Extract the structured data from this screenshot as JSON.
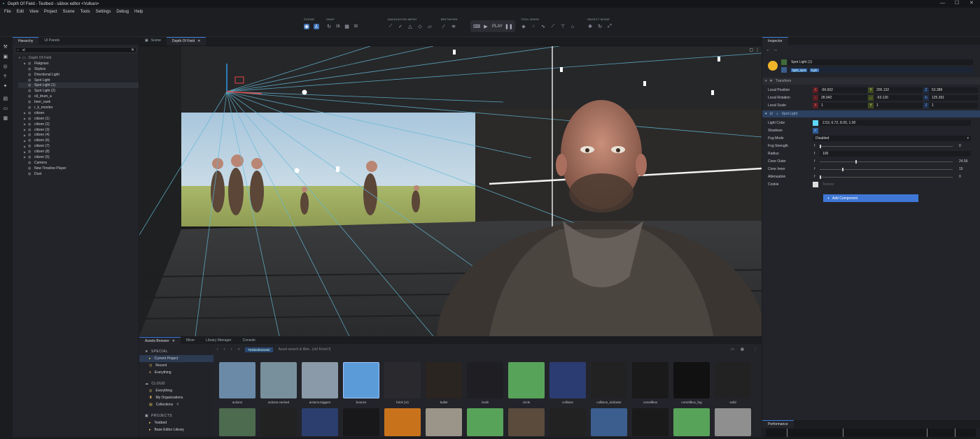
{
  "window": {
    "title": "Depth Of Field - Testbed - s&box editor <Vulkan>"
  },
  "menu": [
    "File",
    "Edit",
    "View",
    "Project",
    "Scene",
    "Tools",
    "Settings",
    "Debug",
    "Help"
  ],
  "toolbar": {
    "groups": [
      "SCENE",
      "SNAP",
      "NAVIGATION MESH",
      "BRITWORK",
      "TOOL MODE",
      "OBJECT MODE"
    ],
    "snap_angle": "15",
    "grid_size": "32",
    "play_label": "PLAY"
  },
  "hierarchy": {
    "tabs": [
      "Hierarchy",
      "UI Panels"
    ],
    "search_value": "sl",
    "root": "Depth Of Field",
    "items": [
      "Flatgrass",
      "Skybox",
      "Directional Light",
      "Spot Light",
      "Spot Light (1)",
      "Spot Light (2)",
      "oil_drum_a",
      "beer_cask",
      "r_k_monitor",
      "citizen",
      "citizen (1)",
      "citizen (2)",
      "citizen (3)",
      "citizen (4)",
      "citizen (6)",
      "citizen (7)",
      "citizen (8)",
      "citizen (5)",
      "Camera",
      "New Timeline Player",
      "Dust"
    ]
  },
  "viewport": {
    "tabs": [
      "Scene",
      "Depth Of Field"
    ]
  },
  "inspector": {
    "tab": "Inspector",
    "object_name": "Spot Light (1)",
    "tags": [
      "light_spot",
      "light"
    ],
    "transform_title": "Transform",
    "position": {
      "label": "Local Position",
      "x": "-56.602",
      "y": "205.132",
      "z": "53.389"
    },
    "rotation": {
      "label": "Local Rotation",
      "x": "28.942",
      "y": "-53.126",
      "z": "125.391"
    },
    "scale": {
      "label": "Local Scale",
      "x": "1",
      "y": "1",
      "z": "1"
    },
    "component_title": "Spot Light",
    "light_color": {
      "label": "Light Color",
      "value": "2.53, 6.72, 8.00, 1.00"
    },
    "shadows": "Shadows",
    "fog_mode": {
      "label": "Fog Mode",
      "value": "Disabled"
    },
    "fog_strength": {
      "label": "Fog Strength",
      "value": "0",
      "fraction": 0.0
    },
    "radius": {
      "label": "Radius",
      "value": "100"
    },
    "cone_outer": {
      "label": "Cone Outer",
      "value": "24.56",
      "fraction": 0.27
    },
    "cone_inner": {
      "label": "Cone Inner",
      "value": "15",
      "fraction": 0.17
    },
    "attenuation": {
      "label": "Attenuation",
      "value": "0",
      "fraction": 0.0
    },
    "cookie": {
      "label": "Cookie",
      "placeholder": "Texture"
    },
    "add_component": "Add Component"
  },
  "assets": {
    "tabs": [
      "Assets Browser",
      "Mixer",
      "Library Manager",
      "Console"
    ],
    "special": {
      "title": "SPECIAL",
      "items": [
        "Current Project",
        "Recent",
        "Everything"
      ]
    },
    "cloud": {
      "title": "CLOUD",
      "items": [
        "Everything",
        "My Organizations",
        "Collections"
      ],
      "collections_count": "4"
    },
    "projects": {
      "title": "PROJECTS",
      "items": [
        "Testbed",
        "Base Editor Library"
      ]
    },
    "path": "Testbed/assets/",
    "search_placeholder": "Asset search & filter.. (ctrl f/cmd f)",
    "tiles": [
      "actions",
      "actions.cached",
      "actions.triggers",
      "bounce",
      "brick (vr)",
      "bullet",
      "bvolt",
      "circle",
      "collision",
      "collision_indicator",
      "cornellbox",
      "cornellbox_fog",
      "solid"
    ]
  },
  "performance": {
    "tab": "Performance"
  },
  "colors": {
    "accent": "#3a7bd5",
    "add_component": "#3f77d6"
  }
}
